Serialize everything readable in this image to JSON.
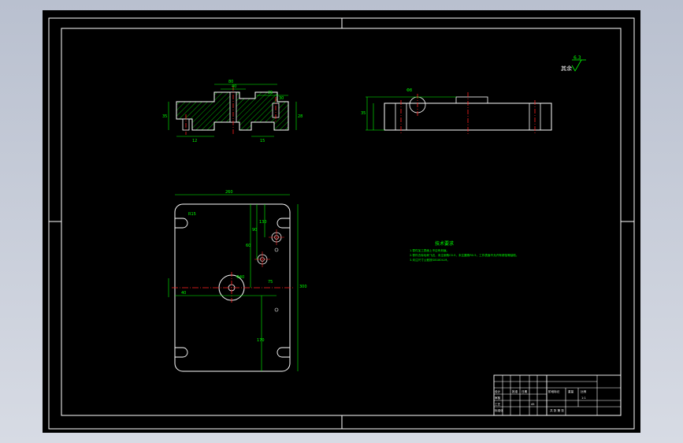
{
  "colors": {
    "frame": "#ffffff",
    "dimension": "#00ff00",
    "centerline": "#ff2020",
    "hatch": "#00ff00",
    "text": "#ffffff",
    "sheet": "#000000"
  },
  "surface_finish": {
    "label": "其余",
    "value": "6.3"
  },
  "technical_requirements": {
    "title": "技术要求",
    "lines": [
      "1.零件加工表面上不应有划痕。",
      "2.零件去除毛刺飞边，未注倒角C0.5，未注圆角R0.5，工件表面不允许有锈蚀等缺陷。",
      "3.未注尺寸公差按GB1804-M。"
    ]
  },
  "dimensions": {
    "top_view_width": "260",
    "section_top": "80",
    "section_mid": "40",
    "section_right_a": "25",
    "section_right_b": "30",
    "left_side_a": "35",
    "left_side_b": "28",
    "bottom_a": "12",
    "bottom_b": "15",
    "side_height": "35",
    "side_hole": "Φ8",
    "plan_corner": "R15",
    "plan_hole_big": "Φ40",
    "plan_y1": "60",
    "plan_y2": "90",
    "plan_y3": "130",
    "plan_y4": "170",
    "plan_x1": "40",
    "plan_x2": "75",
    "plan_height": "300"
  },
  "title_block": {
    "row1": [
      "",
      "",
      "",
      "",
      "",
      "",
      ""
    ],
    "designer_label": "设计",
    "checker_label": "审核",
    "process_label": "工艺",
    "standard_label": "标准化",
    "approve_label": "批准",
    "date_label": "日期",
    "material": "45",
    "part_name": "阶段标记",
    "weight_label": "重量",
    "scale_label": "比例",
    "scale_value": "1:1",
    "sheet_label": "共 张 第 张"
  }
}
